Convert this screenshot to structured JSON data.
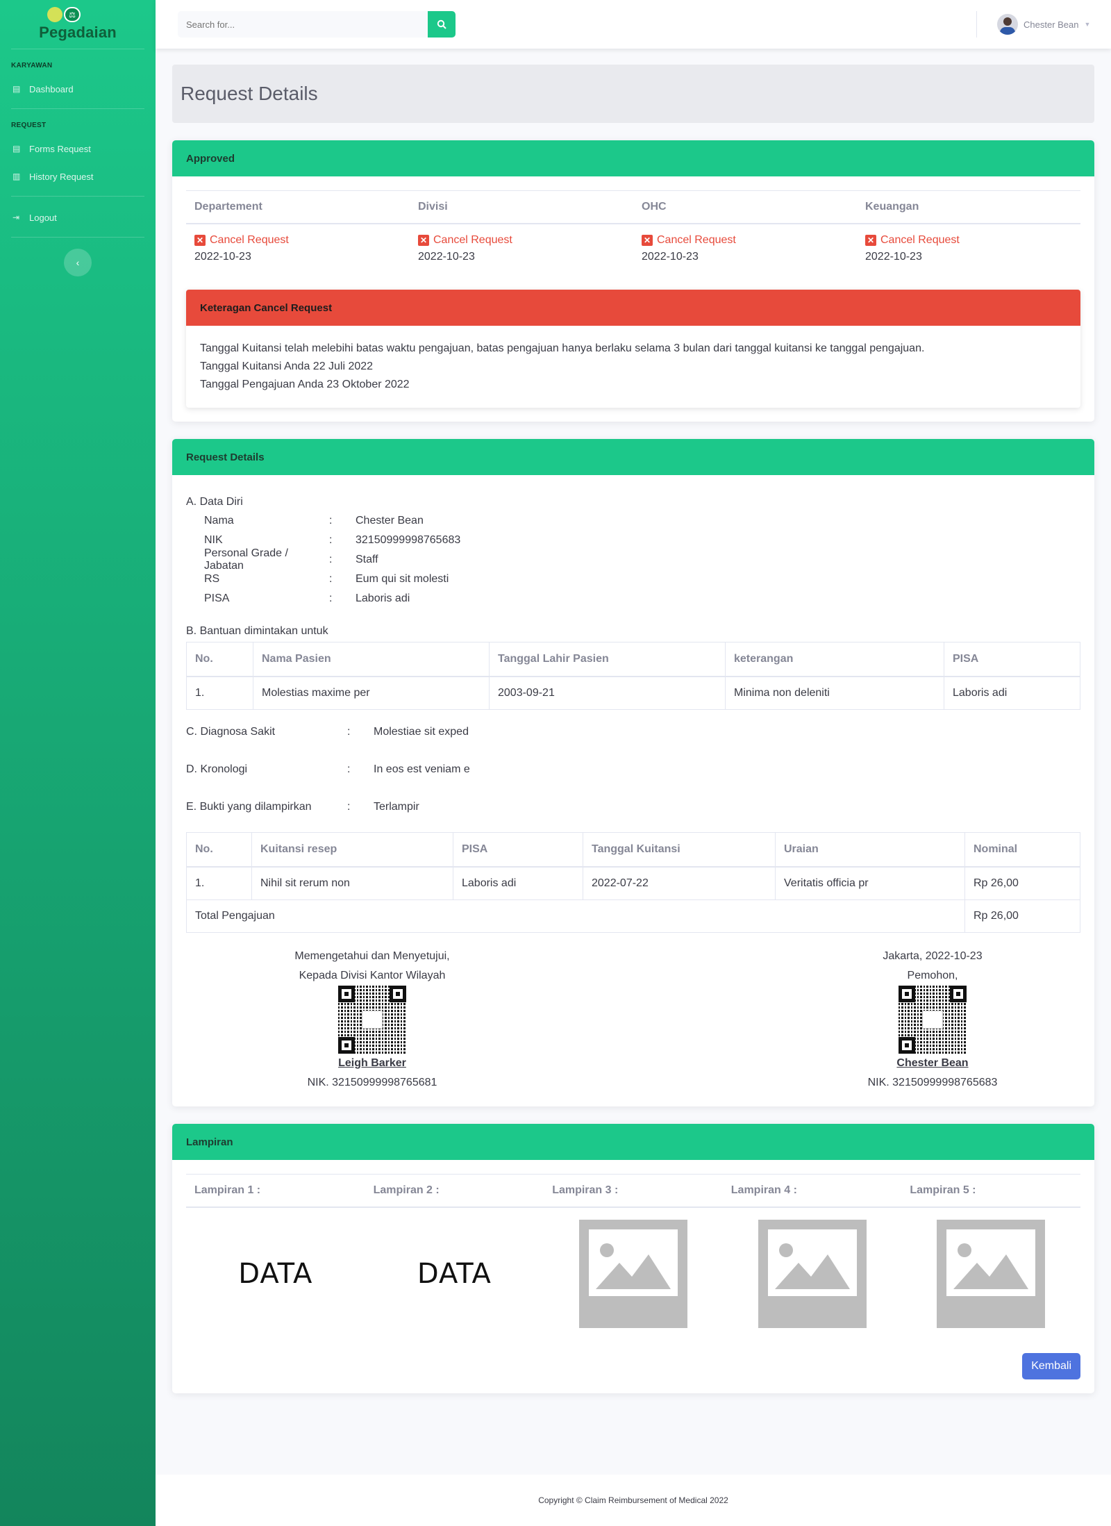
{
  "brand": {
    "name": "Pegadaian"
  },
  "sidebar": {
    "heading_karyawan": "KARYAWAN",
    "heading_request": "REQUEST",
    "items": [
      {
        "label": "Dashboard",
        "icon": "clipboard-icon"
      },
      {
        "label": "Forms Request",
        "icon": "clipboard-icon"
      },
      {
        "label": "History Request",
        "icon": "book-icon"
      },
      {
        "label": "Logout",
        "icon": "sign-out-icon"
      }
    ],
    "toggle_icon": "chevron-left-icon"
  },
  "topbar": {
    "search_placeholder": "Search for...",
    "user_name": "Chester Bean"
  },
  "page": {
    "title": "Request Details"
  },
  "approval": {
    "title": "Approved",
    "columns": [
      "Departement",
      "Divisi",
      "OHC",
      "Keuangan"
    ],
    "statuses": [
      {
        "label": "Cancel Request",
        "date": "2022-10-23"
      },
      {
        "label": "Cancel Request",
        "date": "2022-10-23"
      },
      {
        "label": "Cancel Request",
        "date": "2022-10-23"
      },
      {
        "label": "Cancel Request",
        "date": "2022-10-23"
      }
    ],
    "note_title": "Keteragan Cancel Request",
    "note_lines": [
      "Tanggal Kuitansi telah melebihi batas waktu pengajuan, batas pengajuan hanya berlaku selama 3 bulan dari tanggal kuitansi ke tanggal pengajuan.",
      "Tanggal Kuitansi Anda 22 Juli 2022",
      "Tanggal Pengajuan Anda 23 Oktober 2022"
    ]
  },
  "details": {
    "title": "Request Details",
    "section_a": "A. Data Diri",
    "personal": [
      {
        "label": "Nama",
        "value": "Chester Bean"
      },
      {
        "label": "NIK",
        "value": "32150999998765683"
      },
      {
        "label": "Personal Grade / Jabatan",
        "value": "Staff"
      },
      {
        "label": "RS",
        "value": "Eum qui sit molesti"
      },
      {
        "label": "PISA",
        "value": "Laboris adi"
      }
    ],
    "section_b": "B. Bantuan dimintakan untuk",
    "patients_headers": [
      "No.",
      "Nama Pasien",
      "Tanggal Lahir Pasien",
      "keterangan",
      "PISA"
    ],
    "patients_rows": [
      [
        "1.",
        "Molestias maxime per",
        "2003-09-21",
        "Minima non deleniti",
        "Laboris adi"
      ]
    ],
    "section_c_label": "C. Diagnosa Sakit",
    "section_c_value": "Molestiae sit exped",
    "section_d_label": "D. Kronologi",
    "section_d_value": "In eos est veniam e",
    "section_e_label": "E. Bukti yang dilampirkan",
    "section_e_value": "Terlampir",
    "receipts_headers": [
      "No.",
      "Kuitansi resep",
      "PISA",
      "Tanggal Kuitansi",
      "Uraian",
      "Nominal"
    ],
    "receipts_rows": [
      [
        "1.",
        "Nihil sit rerum non",
        "Laboris adi",
        "2022-07-22",
        "Veritatis officia pr",
        "Rp 26,00"
      ]
    ],
    "total_label": "Total Pengajuan",
    "total_value": "Rp 26,00",
    "colon": ":"
  },
  "signatures": {
    "left": {
      "line1": "Memengetahui dan Menyetujui,",
      "line2": "Kepada Divisi Kantor Wilayah",
      "name": "Leigh Barker",
      "nik": "NIK. 32150999998765681"
    },
    "right": {
      "line1": "Jakarta, 2022-10-23",
      "line2": "Pemohon,",
      "name": "Chester Bean",
      "nik": "NIK. 32150999998765683"
    }
  },
  "attachments": {
    "title": "Lampiran",
    "headers": [
      "Lampiran 1 :",
      "Lampiran 2 :",
      "Lampiran 3 :",
      "Lampiran 4 :",
      "Lampiran 5 :"
    ],
    "data_text_1": "DATA",
    "data_text_2": "DATA",
    "back_label": "Kembali"
  },
  "footer": {
    "text": "Copyright © Claim Reimbursement of Medical 2022"
  },
  "colors": {
    "primary_green": "#1cc88a",
    "danger": "#e74a3b",
    "button_blue": "#4e73df"
  }
}
